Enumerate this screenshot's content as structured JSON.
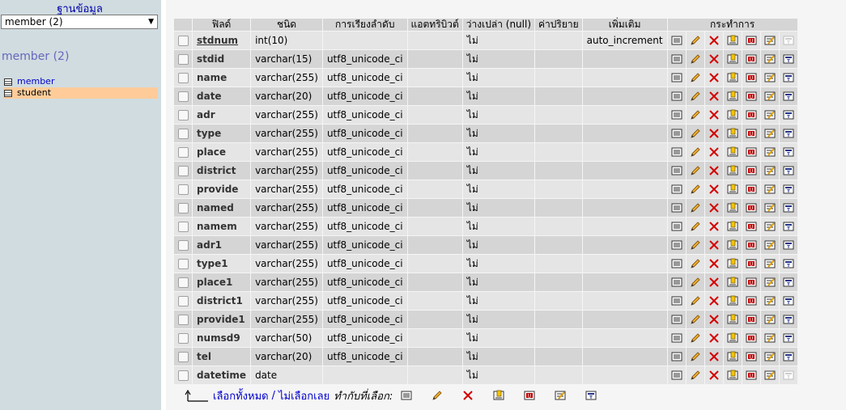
{
  "sidebar": {
    "db_label": "ฐานข้อมูล",
    "db_select_value": "member (2)",
    "db_heading": "member (2)",
    "tables": [
      {
        "name": "member",
        "active": false
      },
      {
        "name": "student",
        "active": true
      }
    ]
  },
  "table": {
    "headers": {
      "field": "ฟิลด์",
      "type": "ชนิด",
      "collation": "การเรียงลำดับ",
      "attributes": "แอตทริบิวต์",
      "null": "ว่างเปล่า (null)",
      "default": "ค่าปริยาย",
      "extra": "เพิ่มเติม",
      "action": "กระทำการ"
    },
    "rows": [
      {
        "name": "stdnum",
        "type": "int(10)",
        "collation": "",
        "attributes": "",
        "null": "ไม่",
        "default": "",
        "extra": "auto_increment",
        "primary": true
      },
      {
        "name": "stdid",
        "type": "varchar(15)",
        "collation": "utf8_unicode_ci",
        "attributes": "",
        "null": "ไม่",
        "default": "",
        "extra": ""
      },
      {
        "name": "name",
        "type": "varchar(255)",
        "collation": "utf8_unicode_ci",
        "attributes": "",
        "null": "ไม่",
        "default": "",
        "extra": ""
      },
      {
        "name": "date",
        "type": "varchar(20)",
        "collation": "utf8_unicode_ci",
        "attributes": "",
        "null": "ไม่",
        "default": "",
        "extra": ""
      },
      {
        "name": "adr",
        "type": "varchar(255)",
        "collation": "utf8_unicode_ci",
        "attributes": "",
        "null": "ไม่",
        "default": "",
        "extra": ""
      },
      {
        "name": "type",
        "type": "varchar(255)",
        "collation": "utf8_unicode_ci",
        "attributes": "",
        "null": "ไม่",
        "default": "",
        "extra": ""
      },
      {
        "name": "place",
        "type": "varchar(255)",
        "collation": "utf8_unicode_ci",
        "attributes": "",
        "null": "ไม่",
        "default": "",
        "extra": ""
      },
      {
        "name": "district",
        "type": "varchar(255)",
        "collation": "utf8_unicode_ci",
        "attributes": "",
        "null": "ไม่",
        "default": "",
        "extra": ""
      },
      {
        "name": "provide",
        "type": "varchar(255)",
        "collation": "utf8_unicode_ci",
        "attributes": "",
        "null": "ไม่",
        "default": "",
        "extra": ""
      },
      {
        "name": "named",
        "type": "varchar(255)",
        "collation": "utf8_unicode_ci",
        "attributes": "",
        "null": "ไม่",
        "default": "",
        "extra": ""
      },
      {
        "name": "namem",
        "type": "varchar(255)",
        "collation": "utf8_unicode_ci",
        "attributes": "",
        "null": "ไม่",
        "default": "",
        "extra": ""
      },
      {
        "name": "adr1",
        "type": "varchar(255)",
        "collation": "utf8_unicode_ci",
        "attributes": "",
        "null": "ไม่",
        "default": "",
        "extra": ""
      },
      {
        "name": "type1",
        "type": "varchar(255)",
        "collation": "utf8_unicode_ci",
        "attributes": "",
        "null": "ไม่",
        "default": "",
        "extra": ""
      },
      {
        "name": "place1",
        "type": "varchar(255)",
        "collation": "utf8_unicode_ci",
        "attributes": "",
        "null": "ไม่",
        "default": "",
        "extra": ""
      },
      {
        "name": "district1",
        "type": "varchar(255)",
        "collation": "utf8_unicode_ci",
        "attributes": "",
        "null": "ไม่",
        "default": "",
        "extra": ""
      },
      {
        "name": "provide1",
        "type": "varchar(255)",
        "collation": "utf8_unicode_ci",
        "attributes": "",
        "null": "ไม่",
        "default": "",
        "extra": ""
      },
      {
        "name": "numsd9",
        "type": "varchar(50)",
        "collation": "utf8_unicode_ci",
        "attributes": "",
        "null": "ไม่",
        "default": "",
        "extra": ""
      },
      {
        "name": "tel",
        "type": "varchar(20)",
        "collation": "utf8_unicode_ci",
        "attributes": "",
        "null": "ไม่",
        "default": "",
        "extra": ""
      },
      {
        "name": "datetime",
        "type": "date",
        "collation": "",
        "attributes": "",
        "null": "ไม่",
        "default": "",
        "extra": ""
      }
    ],
    "actions": [
      "browse-icon",
      "edit-icon",
      "drop-icon",
      "primary-key-icon",
      "unique-icon",
      "index-icon",
      "fulltext-icon"
    ]
  },
  "footer": {
    "check_all": "เลือกทั้งหมด",
    "separator": "/",
    "uncheck_all": "ไม่เลือกเลย",
    "with_selected": "ทำกับที่เลือก:"
  },
  "colors": {
    "sidebar_bg": "#d0dce0",
    "active_table_bg": "#ffcc99",
    "link": "#0000cc",
    "drop_red": "#d40000"
  }
}
